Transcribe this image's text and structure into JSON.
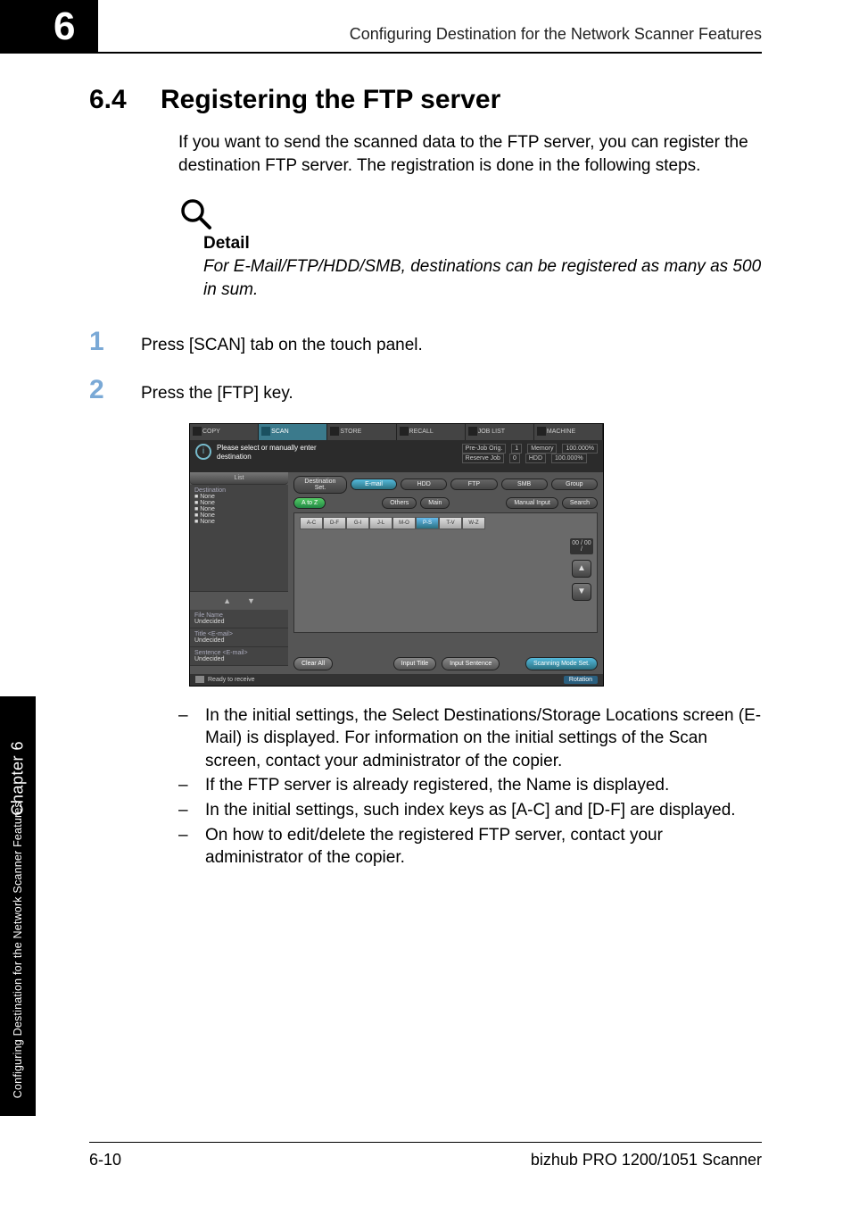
{
  "chapter_tab_number": "6",
  "running_head": "Configuring Destination for the Network Scanner Features",
  "heading": {
    "number": "6.4",
    "title": "Registering the FTP server"
  },
  "intro_para": "If you want to send the scanned data to the FTP server, you can register the destination FTP server. The registration is done in the following steps.",
  "detail": {
    "label": "Detail",
    "text": "For E-Mail/FTP/HDD/SMB, destinations can be registered as many as 500 in sum."
  },
  "steps": [
    {
      "num": "1",
      "text": "Press  [SCAN] tab on the touch panel."
    },
    {
      "num": "2",
      "text": "Press the [FTP] key."
    }
  ],
  "screenshot": {
    "tabs": [
      "COPY",
      "SCAN",
      "STORE",
      "RECALL",
      "JOB LIST",
      "MACHINE"
    ],
    "info_msg_line1": "Please select or manually enter",
    "info_msg_line2": "destination",
    "job_rows": [
      [
        "Pre-Job Orig.",
        "1",
        "Memory",
        "100.000%"
      ],
      [
        "Reserve Job",
        "0",
        "HDD",
        "100.000%"
      ]
    ],
    "left": {
      "list_label": "List",
      "destination_label": "Destination",
      "dest_items": [
        "None",
        "None",
        "None",
        "None",
        "None"
      ],
      "filename_label": "File Name",
      "filename_value": "Undecided",
      "title_label": "Title <E-mail>",
      "title_value": "Undecided",
      "sentence_label": "Sentence <E-mail>",
      "sentence_value": "Undecided"
    },
    "top_pills": [
      "Destination Set.",
      "E-mail",
      "HDD",
      "FTP",
      "SMB",
      "Group"
    ],
    "second_row": {
      "atoz": "A to Z",
      "others": "Others",
      "main": "Main",
      "manual": "Manual Input",
      "search": "Search"
    },
    "index_keys": [
      "A-C",
      "D-F",
      "G-I",
      "J-L",
      "M-O",
      "P-S",
      "T-V",
      "W-Z"
    ],
    "selected_index": "P-S",
    "pager": {
      "count": "00 /\n00 /",
      "up": "▲",
      "down": "▼"
    },
    "bottom": {
      "clear": "Clear All",
      "input_title": "Input Title",
      "input_sentence": "Input Sentence",
      "mode_set": "Scanning Mode Set."
    },
    "status": {
      "ready": "Ready to receive",
      "rotation": "Rotation"
    }
  },
  "bullets": [
    "In the initial settings, the Select Destinations/Storage Locations screen (E-Mail) is displayed. For information on the initial settings of the Scan screen, contact your administrator of the copier.",
    "If the FTP server is already registered, the Name is displayed.",
    "In the initial settings, such index keys as [A-C] and [D-F] are displayed.",
    "On how to edit/delete the registered FTP server, contact your administrator of the copier."
  ],
  "side_tab": {
    "chapter": "Chapter 6",
    "title": "Configuring Destination for the Network Scanner Features"
  },
  "footer": {
    "left": "6-10",
    "right": "bizhub PRO 1200/1051 Scanner"
  }
}
